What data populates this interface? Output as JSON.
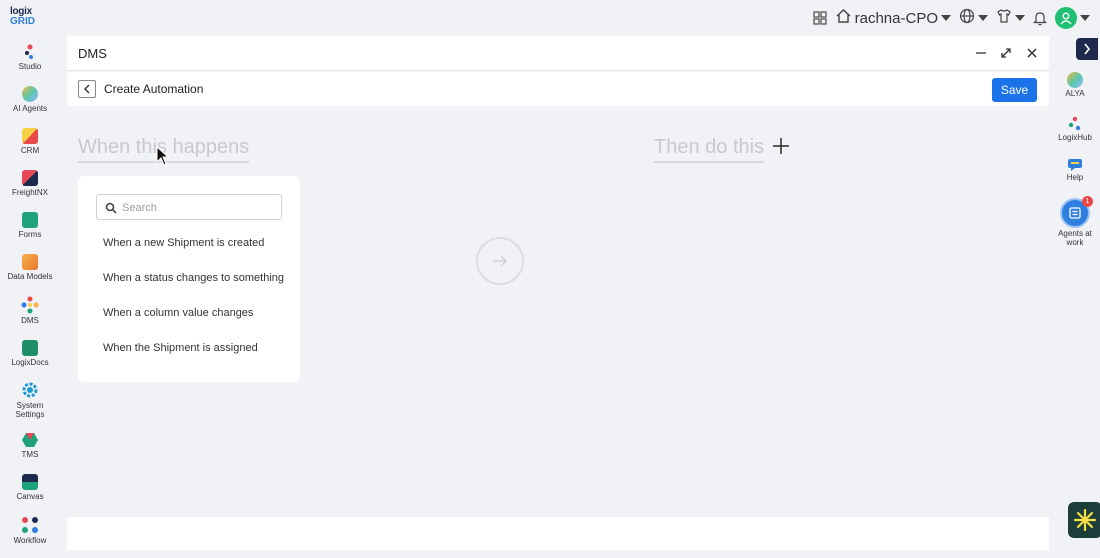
{
  "logo": {
    "line1": "logix",
    "line2": "GRID"
  },
  "topbar": {
    "user": "rachna-CPO"
  },
  "sidebar": {
    "items": [
      {
        "label": "Studio"
      },
      {
        "label": "AI Agents"
      },
      {
        "label": "CRM"
      },
      {
        "label": "FreightNX"
      },
      {
        "label": "Forms"
      },
      {
        "label": "Data Models"
      },
      {
        "label": "DMS"
      },
      {
        "label": "LogixDocs"
      },
      {
        "label": "System Settings"
      },
      {
        "label": "TMS"
      },
      {
        "label": "Canvas"
      },
      {
        "label": "Workflow"
      }
    ]
  },
  "right_sidebar": {
    "items": [
      {
        "label": "ALYA"
      },
      {
        "label": "LogixHub"
      },
      {
        "label": "Help"
      },
      {
        "label": "Agents at work",
        "badge": "1"
      }
    ]
  },
  "window": {
    "title": "DMS",
    "subtitle": "Create Automation",
    "save_label": "Save"
  },
  "builder": {
    "when_title": "When this happens",
    "then_title": "Then do this",
    "search_placeholder": "Search",
    "triggers": [
      "When a new Shipment is created",
      "When a status changes to something",
      "When a column value changes",
      "When the Shipment is assigned"
    ]
  },
  "colors": {
    "accent": "#1a73e8",
    "brand_dark": "#1d2a4d",
    "avatar": "#1fbf74",
    "badge": "#e84848"
  }
}
